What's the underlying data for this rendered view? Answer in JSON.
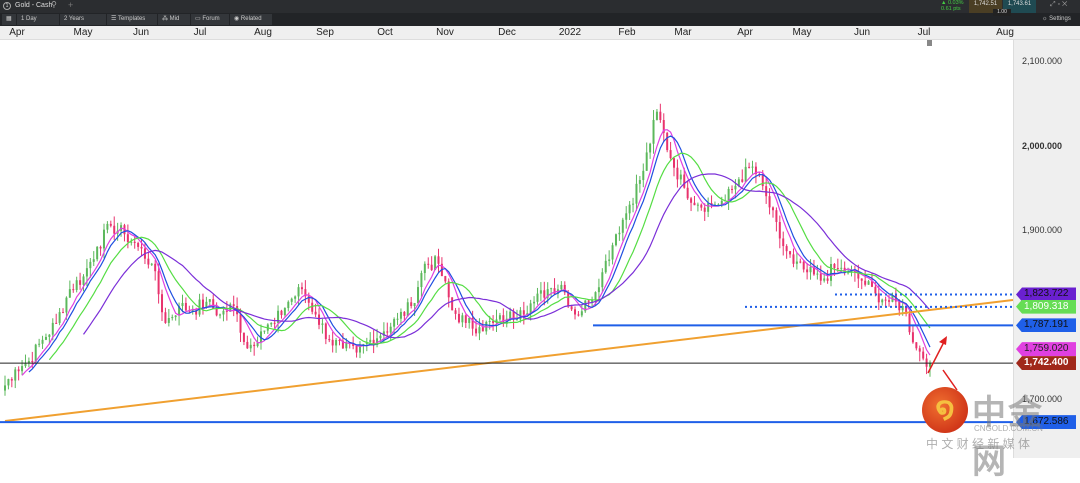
{
  "tab": {
    "title": "Gold - Cash",
    "add": "+"
  },
  "toolbar": {
    "interval": "1 Day",
    "range": "2 Years",
    "templates": "Templates",
    "mid": "Mid",
    "forum": "Forum",
    "related": "Related",
    "settings": "Settings"
  },
  "quote": {
    "change_pct": "▲ 0.03%",
    "change_pts": "0.61 pts",
    "bid": "1,742.51",
    "ask": "1,743.61",
    "spread": "1.00"
  },
  "colors": {
    "up": "#5cb85c",
    "down": "#e8336d",
    "ma_fast": "#1f4fe0",
    "ma_mid": "#55dd44",
    "ma_slow": "#7b2fd8",
    "ma_pink": "#e040e0",
    "trend": "#f0a030",
    "support": "#1f5fe8"
  },
  "chart_data": {
    "type": "candlestick",
    "title": "Gold - Cash",
    "x_ticks": [
      "Apr",
      "May",
      "Jun",
      "Jul",
      "Aug",
      "Sep",
      "Oct",
      "Nov",
      "Dec",
      "2022",
      "Feb",
      "Mar",
      "Apr",
      "May",
      "Jun",
      "Jul",
      "Aug"
    ],
    "y_ticks": [
      "2,100.000",
      "2,000.000",
      "1,900.000",
      "1,700.000"
    ],
    "ylim": [
      1665,
      2140
    ],
    "weekly_closes": [
      1710,
      1735,
      1745,
      1770,
      1790,
      1830,
      1845,
      1880,
      1905,
      1895,
      1880,
      1860,
      1790,
      1810,
      1805,
      1815,
      1800,
      1810,
      1760,
      1780,
      1790,
      1815,
      1830,
      1800,
      1770,
      1760,
      1755,
      1770,
      1780,
      1795,
      1810,
      1860,
      1860,
      1805,
      1790,
      1785,
      1790,
      1795,
      1805,
      1815,
      1830,
      1835,
      1800,
      1815,
      1850,
      1895,
      1930,
      1970,
      2040,
      1985,
      1950,
      1930,
      1930,
      1935,
      1960,
      1975,
      1940,
      1890,
      1860,
      1850,
      1840,
      1855,
      1850,
      1840,
      1825,
      1815,
      1810,
      1760,
      1742.4
    ],
    "levels": [
      {
        "label": "1,823.722",
        "value": 1823.722,
        "color": "#6a20d0",
        "style": "dotted"
      },
      {
        "label": "1,809.318",
        "value": 1809.318,
        "color": "#66dd55",
        "style": "ma"
      },
      {
        "label": "1,787.191",
        "value": 1787.191,
        "color": "#1f5fe8",
        "style": "solid"
      },
      {
        "label": "1,759.020",
        "value": 1759.02,
        "color": "#e040e0",
        "style": "ma"
      },
      {
        "label": "1,742.400",
        "value": 1742.4,
        "color": "#a0281a",
        "style": "price"
      },
      {
        "label": "1,672.586",
        "value": 1672.586,
        "color": "#1f5fe8",
        "style": "solid"
      }
    ]
  },
  "watermark": {
    "brand": "中金网",
    "domain": "CNGOLD.COM.CN",
    "slogan": "中 文 财 经 新 媒 体"
  }
}
